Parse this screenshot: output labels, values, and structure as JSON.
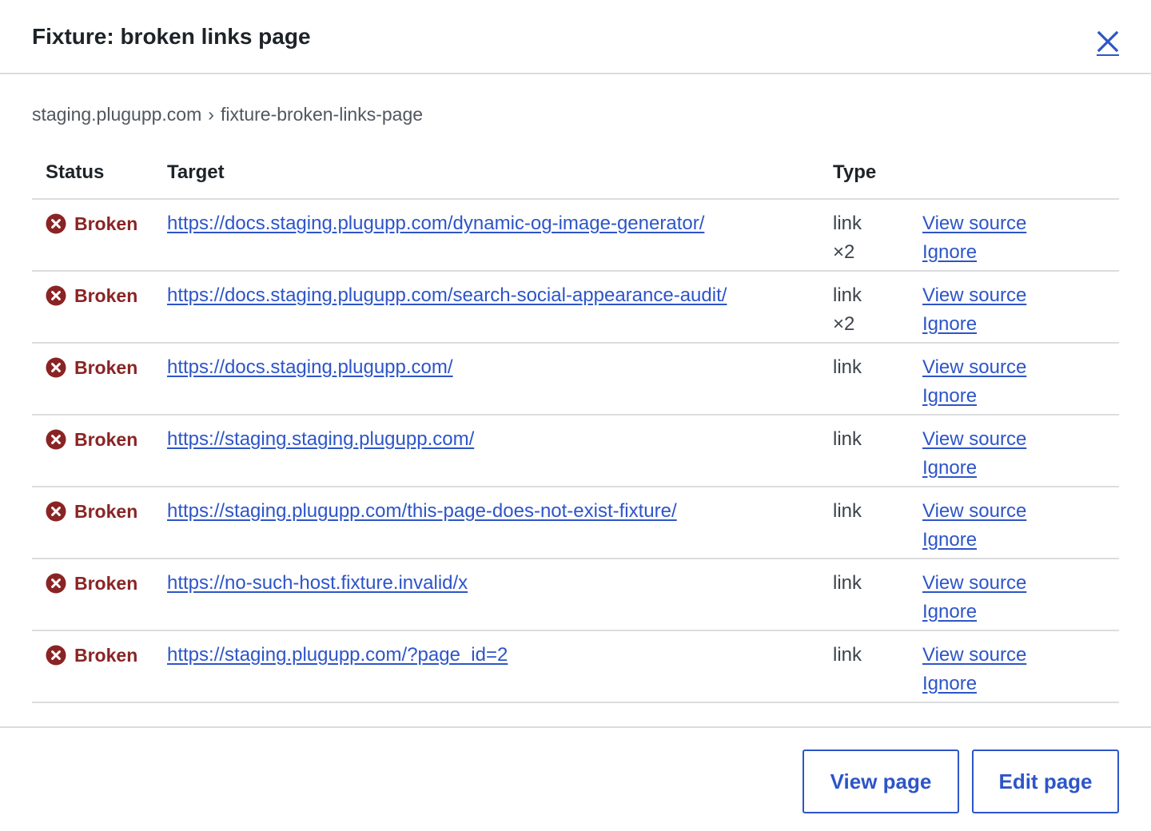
{
  "dialog": {
    "title": "Fixture: broken links page",
    "close_label": "Close"
  },
  "breadcrumb": {
    "site": "staging.plugupp.com",
    "separator": "›",
    "page": "fixture-broken-links-page"
  },
  "table": {
    "headers": {
      "status": "Status",
      "target": "Target",
      "type": "Type",
      "actions": ""
    },
    "rows": [
      {
        "status": "Broken",
        "target": "https://docs.staging.plugupp.com/dynamic-og-image-generator/",
        "type": "link",
        "count": "×2",
        "view_source": "View source",
        "ignore": "Ignore"
      },
      {
        "status": "Broken",
        "target": "https://docs.staging.plugupp.com/search-social-appearance-audit/",
        "type": "link",
        "count": "×2",
        "view_source": "View source",
        "ignore": "Ignore"
      },
      {
        "status": "Broken",
        "target": "https://docs.staging.plugupp.com/",
        "type": "link",
        "count": "",
        "view_source": "View source",
        "ignore": "Ignore"
      },
      {
        "status": "Broken",
        "target": "https://staging.staging.plugupp.com/",
        "type": "link",
        "count": "",
        "view_source": "View source",
        "ignore": "Ignore"
      },
      {
        "status": "Broken",
        "target": "https://staging.plugupp.com/this-page-does-not-exist-fixture/",
        "type": "link",
        "count": "",
        "view_source": "View source",
        "ignore": "Ignore"
      },
      {
        "status": "Broken",
        "target": "https://no-such-host.fixture.invalid/x",
        "type": "link",
        "count": "",
        "view_source": "View source",
        "ignore": "Ignore"
      },
      {
        "status": "Broken",
        "target": "https://staging.plugupp.com/?page_id=2",
        "type": "link",
        "count": "",
        "view_source": "View source",
        "ignore": "Ignore"
      }
    ]
  },
  "footer": {
    "view_page_label": "View page",
    "edit_page_label": "Edit page"
  },
  "colors": {
    "accent": "#2d55c8",
    "error": "#8a2424",
    "border": "#dcdcde"
  },
  "icons": {
    "status_icon": "error-circle-x-icon",
    "close_icon": "close-icon"
  }
}
